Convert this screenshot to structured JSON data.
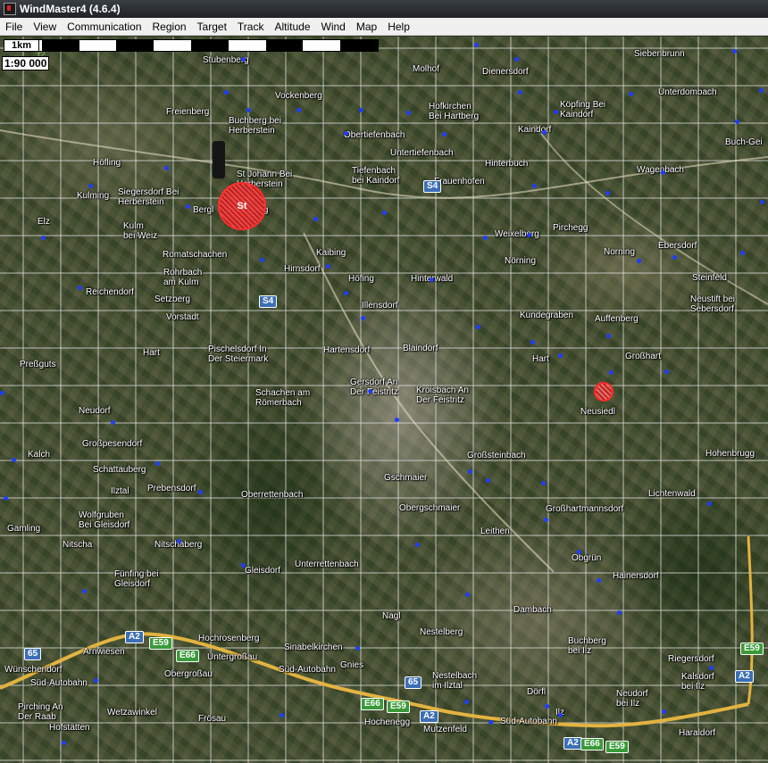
{
  "window": {
    "title": "WindMaster4 (4.6.4)"
  },
  "menu": [
    "File",
    "View",
    "Communication",
    "Region",
    "Target",
    "Track",
    "Altitude",
    "Wind",
    "Map",
    "Help"
  ],
  "map": {
    "scale_label": "1km",
    "scale_ratio": "1:90 000",
    "partial_label": "r2",
    "markers": [
      {
        "id": "start",
        "label": "St"
      },
      {
        "id": "target",
        "label": ""
      }
    ],
    "road_shields": [
      {
        "text": "S4",
        "color": "blue"
      },
      {
        "text": "S4",
        "color": "blue"
      },
      {
        "text": "A2",
        "color": "blue"
      },
      {
        "text": "E59",
        "color": "green"
      },
      {
        "text": "E66",
        "color": "green"
      },
      {
        "text": "65",
        "color": "blue"
      },
      {
        "text": "65",
        "color": "blue"
      },
      {
        "text": "E66",
        "color": "green"
      },
      {
        "text": "E59",
        "color": "green"
      },
      {
        "text": "A2",
        "color": "blue"
      },
      {
        "text": "A2",
        "color": "blue"
      },
      {
        "text": "E66",
        "color": "green"
      },
      {
        "text": "E59",
        "color": "green"
      },
      {
        "text": "E59",
        "color": "green"
      },
      {
        "text": "A2",
        "color": "blue"
      }
    ],
    "places": [
      "Stubenberg",
      "Molhof",
      "Dienersdorf",
      "Siebenbrunn",
      "Freienberg",
      "Vockenberg",
      "Buchberg bei\nHerberstein",
      "Hofkirchen\nBei Hartberg",
      "Unterdombach",
      "Köpfing Bei\nKaindorf",
      "Kaindorf",
      "Obertiefenbach",
      "Buch-Gei",
      "Untertiefenbach",
      "Hinterbuch",
      "Höfling",
      "St Johann Bei\nHerberstein",
      "Tiefenbach\nbei Kaindorf",
      "Frauenhofen",
      "Wagenbach",
      "Kulming",
      "Siegersdorf Bei\nHerberstein",
      "Bergl",
      "Hoferberg",
      "Elz",
      "Kulm\nbei Weiz",
      "Pirchegg",
      "Weixelberg",
      "Ebersdorf",
      "Romatschachen",
      "Kaibing",
      "Nörning",
      "Norning",
      "Rohrbach\nam Kulm",
      "Hirnsdorf",
      "Steinfeld",
      "Höfing",
      "Hinterwald",
      "Reichendorf",
      "Setzberg",
      "Neustift bei\nSebersdorf",
      "Vorstadt",
      "Illensdorf",
      "Kundegraben",
      "Auffenberg",
      "Pischelsdorf In\nDer Steiermark",
      "Hartensdorf",
      "Blaindorf",
      "Hart",
      "Großhart",
      "Preßguts",
      "Hart",
      "Gersdorf An\nDer Feistritz",
      "Schachen am\nRömerbach",
      "Kroisbach An\nDer Feistritz",
      "Neusiedl",
      "Neudorf",
      "Großpesendorf",
      "Kalch",
      "Großsteinbach",
      "Hohenbrugg",
      "Schattauberg",
      "Gschmaier",
      "Ilztal",
      "Prebensdorf",
      "Oberrettenbach",
      "Lichtenwald",
      "Obergschmaier",
      "Großhartmannsdorf",
      "Wolfgruben\nBei Gleisdorf",
      "Gamling",
      "Leithen",
      "Nitscha",
      "Nitschaberg",
      "Obgrün",
      "Fünfing bei\nGleisdorf",
      "Gleisdorf",
      "Unterrettenbach",
      "Hainersdorf",
      "Nagl",
      "Dambach",
      "Nestelberg",
      "Hochrosenberg",
      "Sinabelkirchen",
      "Buchberg\nbei Ilz",
      "Arnwiesen",
      "Untergroßau",
      "Riegersdorf",
      "Wünschendorf",
      "Obergroßau",
      "Gnies",
      "Nestelbach\nim Ilztal",
      "Kalsdorf\nbei Ilz",
      "Pirching An\nDer Raab",
      "Wetzawinkel",
      "Frösau",
      "Dörfl",
      "Ilz",
      "Neudorf\nbei Ilz",
      "Hochenegg",
      "Hofstätten",
      "Mutzenfeld",
      "Süd-Autobahn",
      "Süd-Autobahn",
      "Süd-Autobahn",
      "Haraldorf"
    ]
  }
}
